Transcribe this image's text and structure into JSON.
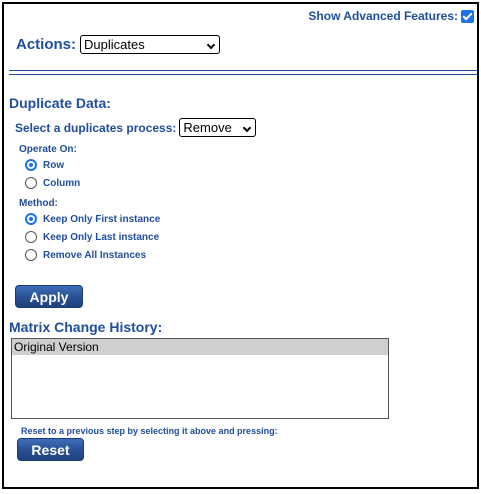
{
  "advanced": {
    "label": "Show Advanced Features:",
    "checked": true
  },
  "actions": {
    "label": "Actions:",
    "selected": "Duplicates"
  },
  "duplicate": {
    "title": "Duplicate Data:",
    "process_label": "Select a duplicates process:",
    "process_selected": "Remove",
    "operate_label": "Operate On:",
    "operate_options": [
      "Row",
      "Column"
    ],
    "method_label": "Method:",
    "method_options": [
      "Keep Only First instance",
      "Keep Only Last instance",
      "Remove All Instances"
    ],
    "apply_label": "Apply"
  },
  "history": {
    "title": "Matrix Change History:",
    "items": [
      "Original Version"
    ],
    "reset_note": "Reset to a previous step by selecting it above and pressing:",
    "reset_label": "Reset"
  },
  "colors": {
    "accent": "#1f4e9c",
    "check": "#1a73e8"
  }
}
